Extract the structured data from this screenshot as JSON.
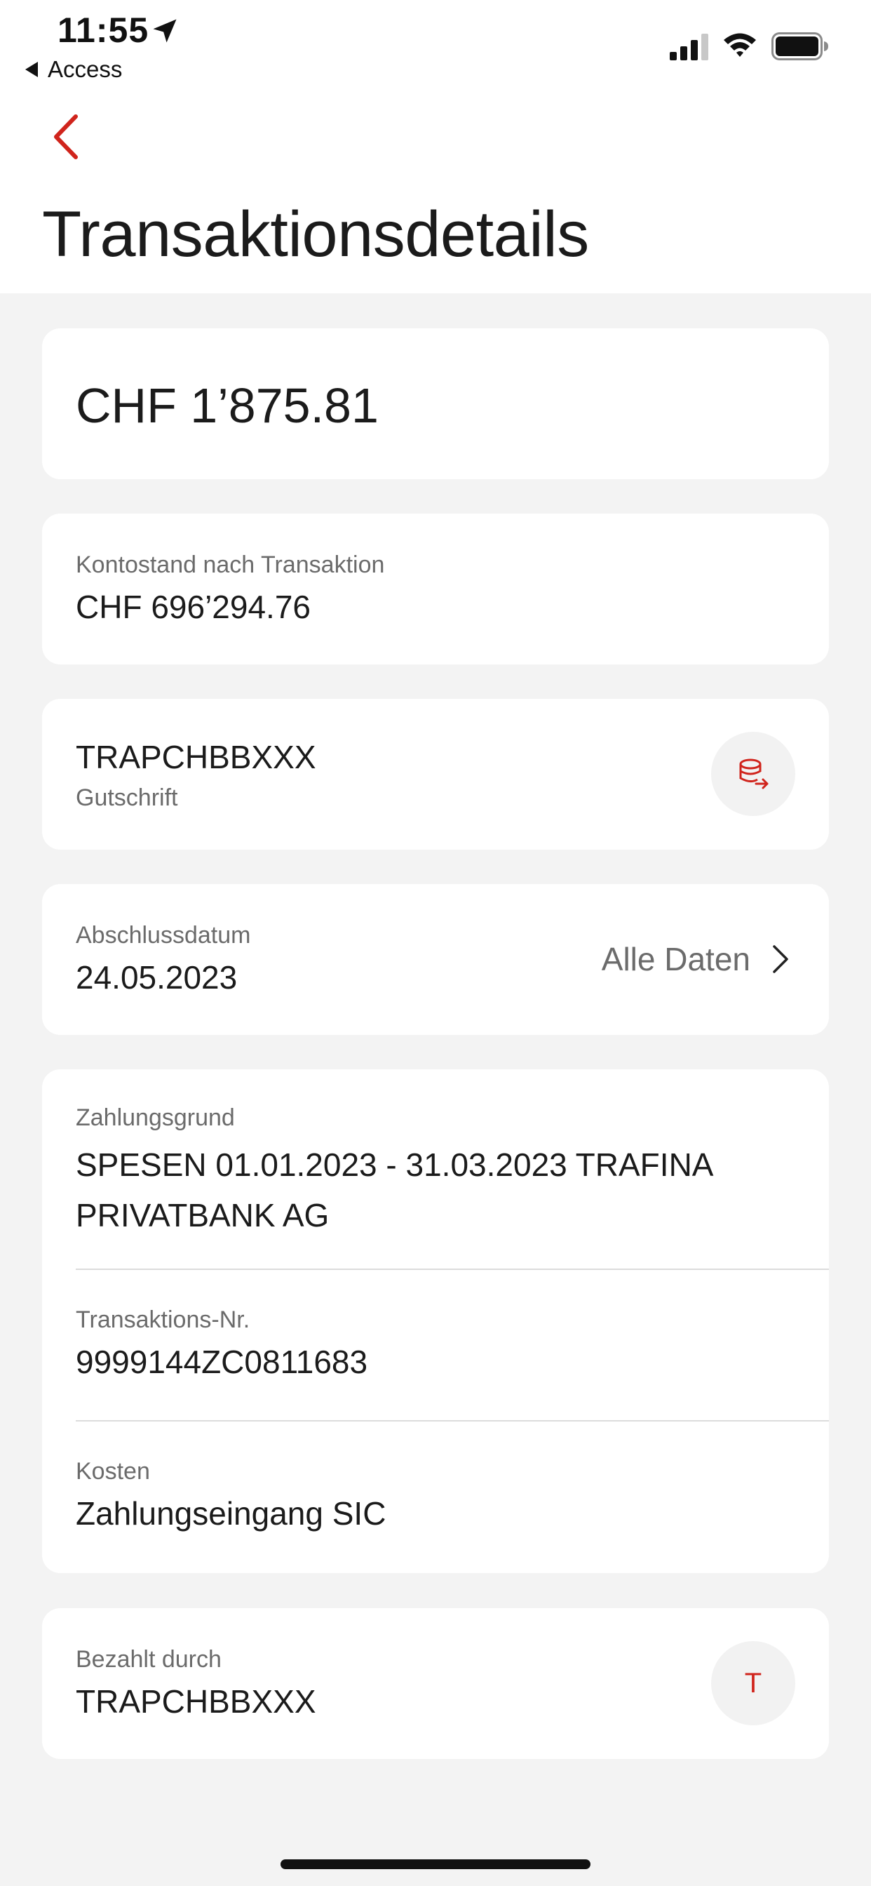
{
  "status_bar": {
    "time": "11:55",
    "back_app_label": "Access"
  },
  "header": {
    "title": "Transaktionsdetails"
  },
  "amount_card": {
    "amount": "CHF 1’875.81"
  },
  "balance_card": {
    "label": "Kontostand nach Transaktion",
    "value": "CHF 696’294.76"
  },
  "counterparty_card": {
    "name": "TRAPCHBBXXX",
    "type": "Gutschrift",
    "icon": "coins-transfer-icon"
  },
  "date_card": {
    "label": "Abschlussdatum",
    "value": "24.05.2023",
    "link_label": "Alle Daten"
  },
  "details_card": {
    "reason_label": "Zahlungsgrund",
    "reason_value": "SPESEN 01.01.2023 - 31.03.2023 TRAFINA PRIVATBANK AG",
    "transaction_no_label": "Transaktions-Nr.",
    "transaction_no_value": "9999144ZC0811683",
    "costs_label": "Kosten",
    "costs_value": "Zahlungseingang SIC"
  },
  "paid_by_card": {
    "label": "Bezahlt durch",
    "value": "TRAPCHBBXXX",
    "avatar_letter": "T"
  },
  "colors": {
    "accent": "#d0241c",
    "background": "#f3f3f3",
    "card": "#ffffff",
    "label_text": "#6b6b6b"
  }
}
